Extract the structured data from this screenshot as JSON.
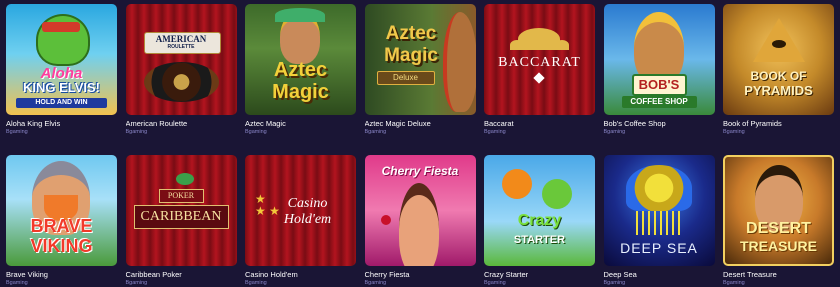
{
  "games": [
    {
      "title": "Aloha King Elvis",
      "provider": "Bgaming",
      "art": [
        "Aloha",
        "KING ELVIS!",
        "HOLD AND WIN"
      ],
      "icon": "frog-elvis-icon"
    },
    {
      "title": "American Roulette",
      "provider": "Bgaming",
      "art": [
        "AMERICAN",
        "ROULETTE"
      ],
      "icon": "roulette-wheel-icon"
    },
    {
      "title": "Aztec Magic",
      "provider": "Bgaming",
      "art": [
        "Aztec",
        "Magic"
      ],
      "icon": "aztec-queen-icon"
    },
    {
      "title": "Aztec Magic Deluxe",
      "provider": "Bgaming",
      "art": [
        "Aztec",
        "Magic",
        "Deluxe"
      ],
      "icon": "aztec-warrior-icon"
    },
    {
      "title": "Baccarat",
      "provider": "Bgaming",
      "art": [
        "BACCARAT"
      ],
      "icon": "diamond-icon"
    },
    {
      "title": "Bob's Coffee Shop",
      "provider": "Bgaming",
      "art": [
        "BOB'S",
        "COFFEE SHOP"
      ],
      "icon": "bob-character-icon"
    },
    {
      "title": "Book of Pyramids",
      "provider": "Bgaming",
      "art": [
        "BOOK OF",
        "PYRAMIDS"
      ],
      "icon": "pyramid-eye-icon"
    },
    {
      "title": "Brave Viking",
      "provider": "Bgaming",
      "art": [
        "BRAVE",
        "VIKING"
      ],
      "icon": "viking-icon"
    },
    {
      "title": "Caribbean Poker",
      "provider": "Bgaming",
      "art": [
        "POKER",
        "CARIBBEAN"
      ],
      "icon": "palm-tree-icon"
    },
    {
      "title": "Casino Hold'em",
      "provider": "Bgaming",
      "art": [
        "Casino",
        "Hold'em"
      ],
      "icon": "stars-icon"
    },
    {
      "title": "Cherry Fiesta",
      "provider": "Bgaming",
      "art": [
        "Cherry Fiesta"
      ],
      "icon": "cherry-girl-icon"
    },
    {
      "title": "Crazy Starter",
      "provider": "Bgaming",
      "art": [
        "Crazy",
        "STARTER"
      ],
      "icon": "fruit-characters-icon"
    },
    {
      "title": "Deep Sea",
      "provider": "Bgaming",
      "art": [
        "DEEP SEA"
      ],
      "icon": "jellyfish-icon"
    },
    {
      "title": "Desert Treasure",
      "provider": "Bgaming",
      "art": [
        "DESERT",
        "TREASURE"
      ],
      "icon": "desert-princess-icon"
    }
  ]
}
